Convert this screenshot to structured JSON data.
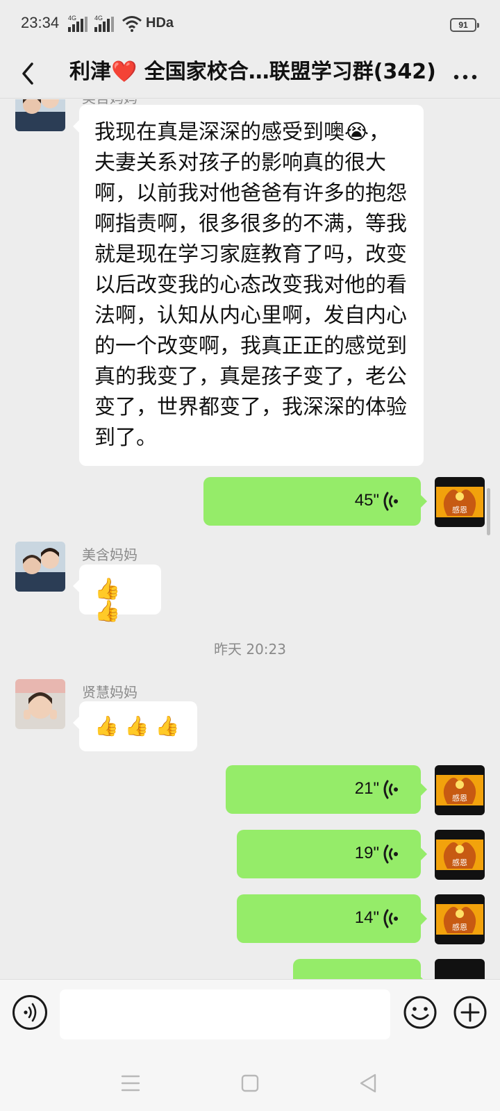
{
  "status_bar": {
    "time": "23:34",
    "signal1_label": "4G",
    "signal2_label": "4G",
    "hd_label": "HDa",
    "battery": "91"
  },
  "nav": {
    "title_prefix": "利津",
    "title_heart": "❤️",
    "title_rest": " 全国家校合…联盟学习群(342)",
    "back_icon": "chevron-left-icon",
    "more_icon": "more-dots-icon"
  },
  "messages": [
    {
      "sender": "美含妈妈",
      "type": "text",
      "text": "我现在真是深深的感受到噢😭，\n夫妻关系对孩子的影响真的很大\n啊，以前我对他爸爸有许多的抱怨\n啊指责啊，很多很多的不满，等我\n就是现在学习家庭教育了吗，改变\n以后改变我的心态改变我对他的看\n法啊，认知从内心里啊，发自内心\n的一个改变啊，我真正正的感觉到\n真的我变了，真是孩子变了，老公\n变了，世界都变了，我深深的体验\n到了。"
    },
    {
      "type": "voice",
      "direction": "out",
      "duration": "45\""
    },
    {
      "sender": "美含妈妈",
      "type": "emoji",
      "text": "👍👍"
    },
    {
      "type": "time",
      "text": "昨天 20:23"
    },
    {
      "sender": "贤慧妈妈",
      "type": "emoji",
      "text": "👍 👍 👍"
    },
    {
      "type": "voice",
      "direction": "out",
      "duration": "21\""
    },
    {
      "type": "voice",
      "direction": "out",
      "duration": "19\""
    },
    {
      "type": "voice",
      "direction": "out",
      "duration": "14\""
    }
  ],
  "self_avatar": {
    "text": "感恩"
  },
  "input_bar": {
    "voice_icon": "voice-toggle-icon",
    "placeholder": "",
    "emoji_icon": "emoji-icon",
    "plus_icon": "plus-icon"
  },
  "colors": {
    "out_bubble": "#95ec69",
    "in_bubble": "#ffffff",
    "background": "#ededed"
  }
}
